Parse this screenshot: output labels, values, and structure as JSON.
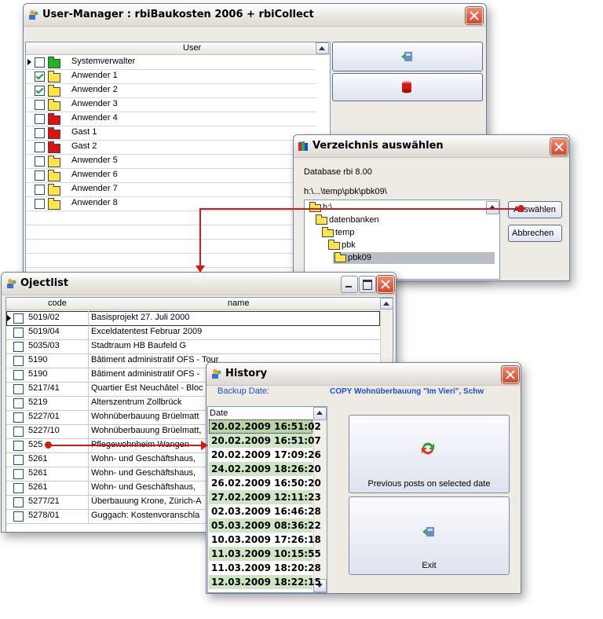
{
  "user_manager": {
    "title": "User-Manager : rbiBaukosten 2006 + rbiCollect",
    "column_header": "User",
    "users": [
      {
        "name": "Systemverwalter",
        "checked": false,
        "folder": "green"
      },
      {
        "name": "Anwender 1",
        "checked": true,
        "folder": "open"
      },
      {
        "name": "Anwender 2",
        "checked": true,
        "folder": "open"
      },
      {
        "name": "Anwender 3",
        "checked": false,
        "folder": "yellow"
      },
      {
        "name": "Anwender 4",
        "checked": false,
        "folder": "red"
      },
      {
        "name": "Gast 1",
        "checked": false,
        "folder": "red"
      },
      {
        "name": "Gast 2",
        "checked": false,
        "folder": "red"
      },
      {
        "name": "Anwender 5",
        "checked": false,
        "folder": "yellow"
      },
      {
        "name": "Anwender 6",
        "checked": false,
        "folder": "yellow"
      },
      {
        "name": "Anwender 7",
        "checked": false,
        "folder": "yellow"
      },
      {
        "name": "Anwender 8",
        "checked": false,
        "folder": "yellow"
      }
    ]
  },
  "folder_dialog": {
    "title": "Verzeichnis auswählen",
    "database": "Database rbi 8.00",
    "path": "h:\\...\\temp\\pbk\\pbk09\\",
    "tree": [
      "h:\\",
      "datenbanken",
      "temp",
      "pbk",
      "pbk09"
    ],
    "select_label": "Auswählen",
    "cancel_label": "Abbrechen"
  },
  "objectlist": {
    "title": "Ojectlist",
    "col_code": "code",
    "col_name": "name",
    "rows": [
      {
        "code": "5019/02",
        "name": "Basisprojekt 27. Juli 2000"
      },
      {
        "code": "5019/04",
        "name": "Exceldatentest Februar 2009"
      },
      {
        "code": "5035/03",
        "name": "Stadtraum HB Baufeld G"
      },
      {
        "code": "5190",
        "name": "Bâtiment administratif OFS - Tour"
      },
      {
        "code": "5190",
        "name": "Bâtiment administratif OFS -"
      },
      {
        "code": "5217/41",
        "name": "Quartier Est Neuchâtel - Bloc"
      },
      {
        "code": "5219",
        "name": "Alterszentrum Zollbrück"
      },
      {
        "code": "5227/01",
        "name": "Wohnüberbauung Brüelmatt"
      },
      {
        "code": "5227/10",
        "name": "Wohnüberbauung Brüelmatt,"
      },
      {
        "code": "525",
        "name": "Pflegewohnheim Wangen"
      },
      {
        "code": "5261",
        "name": "Wohn- und Geschäftshaus,"
      },
      {
        "code": "5261",
        "name": "Wohn- und Geschäftshaus,"
      },
      {
        "code": "5261",
        "name": "Wohn- und Geschäftshaus,"
      },
      {
        "code": "5277/21",
        "name": "Überbauung Krone, Zürich-A"
      },
      {
        "code": "5278/01",
        "name": "Guggach: Kostenvoranschla"
      }
    ]
  },
  "history": {
    "title": "History",
    "backup_label": "Backup Date:",
    "copy_label": "COPY Wohnüberbauung \"Im Vieri\", Schw",
    "date_header": "Date",
    "dates": [
      "20.02.2009 16:51:02",
      "20.02.2009 16:51:07",
      "20.02.2009 17:09:26",
      "24.02.2009 18:26:20",
      "26.02.2009 16:50:20",
      "27.02.2009 12:11:23",
      "02.03.2009 16:46:28",
      "05.03.2009 08:36:22",
      "10.03.2009 17:26:18",
      "11.03.2009 10:15:55",
      "11.03.2009 18:20:28",
      "12.03.2009 18:22:15"
    ],
    "previous_label": "Previous posts on selected date",
    "exit_label": "Exit"
  },
  "colors": {
    "accent_red": "#d11a1a",
    "row_green": "#cfe6c6",
    "selected_row": "#b9d3a8",
    "title_blue": "#1b4fd6"
  }
}
